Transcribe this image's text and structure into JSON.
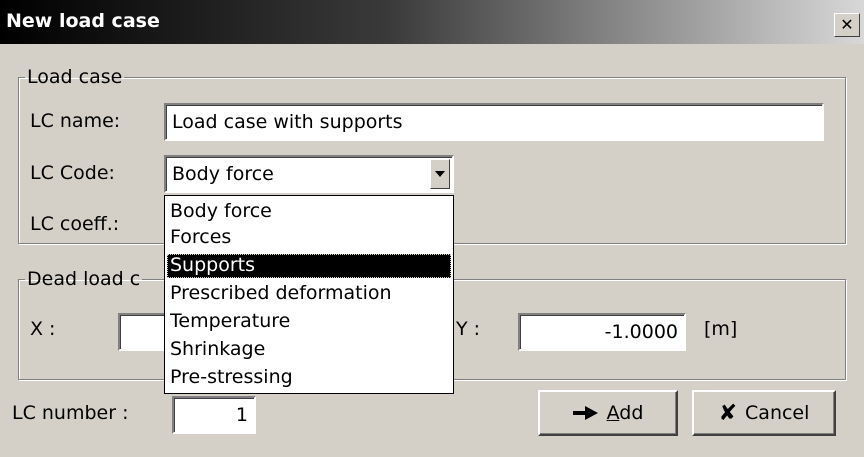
{
  "window": {
    "title": "New load case",
    "close_glyph": "✕"
  },
  "load_case_group": {
    "legend": "Load case",
    "lc_name": {
      "label": "LC name:",
      "value": "Load case with supports"
    },
    "lc_code": {
      "label": "LC Code:",
      "value": "Body force",
      "options": [
        "Body force",
        "Forces",
        "Supports",
        "Prescribed deformation",
        "Temperature",
        "Shrinkage",
        "Pre-stressing"
      ],
      "highlighted": "Supports"
    },
    "lc_coeff": {
      "label": "LC coeff.:"
    }
  },
  "dead_load_group": {
    "legend": "Dead load c",
    "x": {
      "label": "X :"
    },
    "y": {
      "label": "Y :",
      "value": "-1.0000",
      "unit": "[m]"
    }
  },
  "lc_number": {
    "label": "LC number :",
    "value": "1"
  },
  "buttons": {
    "add": {
      "prefix": "",
      "accel": "A",
      "rest": "dd"
    },
    "cancel": "Cancel"
  }
}
